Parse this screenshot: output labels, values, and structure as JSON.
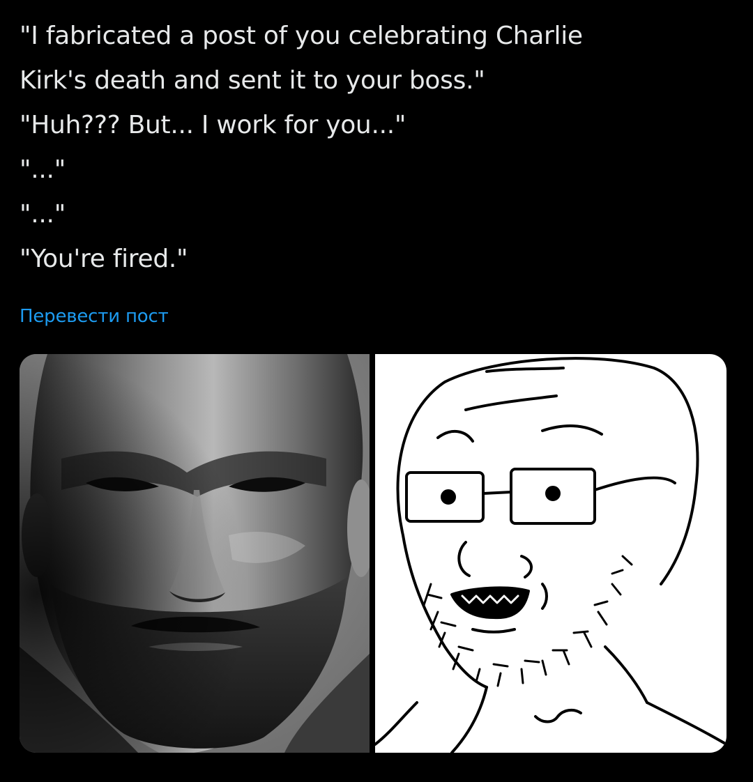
{
  "post": {
    "lines": [
      "\"I fabricated a post of you celebrating Charlie",
      "Kirk's death and sent it to your boss.\"",
      "\"Huh??? But... I work for you...\"",
      "\"...\"",
      "\"...\"",
      "\"You're fired.\""
    ],
    "translate_label": "Перевести пост"
  },
  "media": {
    "images": [
      {
        "subject": "gigachad-photo"
      },
      {
        "subject": "wojak-drawing"
      }
    ]
  },
  "colors": {
    "background": "#000000",
    "text": "#e7e9ea",
    "link": "#1d9bf0"
  }
}
